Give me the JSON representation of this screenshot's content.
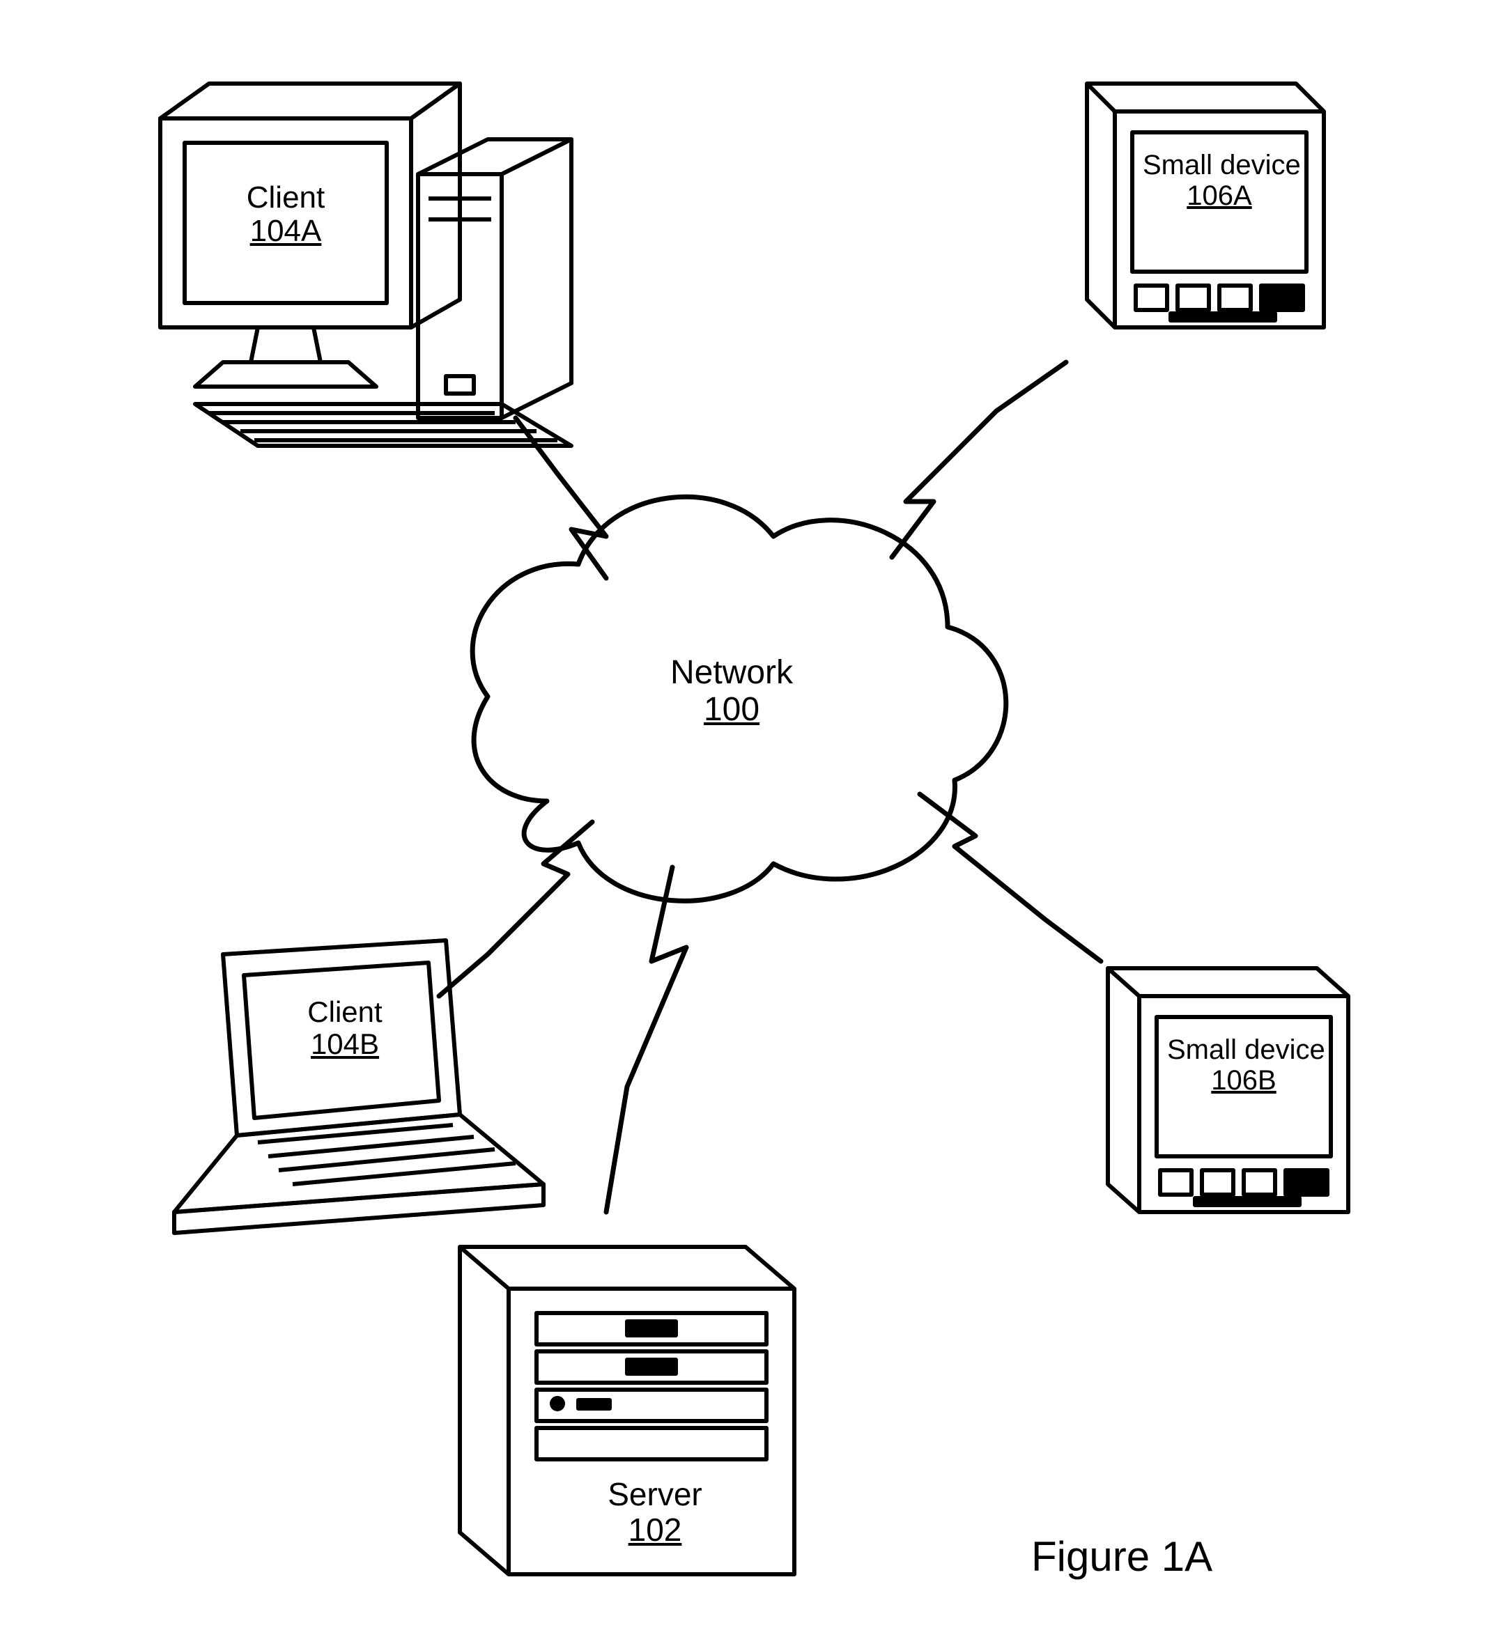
{
  "figure_label": "Figure 1A",
  "network": {
    "name": "Network",
    "ref": "100"
  },
  "server": {
    "name": "Server",
    "ref": "102"
  },
  "client_a": {
    "name": "Client",
    "ref": "104A"
  },
  "client_b": {
    "name": "Client",
    "ref": "104B"
  },
  "small_a": {
    "name": "Small device",
    "ref": "106A"
  },
  "small_b": {
    "name": "Small device",
    "ref": "106B"
  }
}
